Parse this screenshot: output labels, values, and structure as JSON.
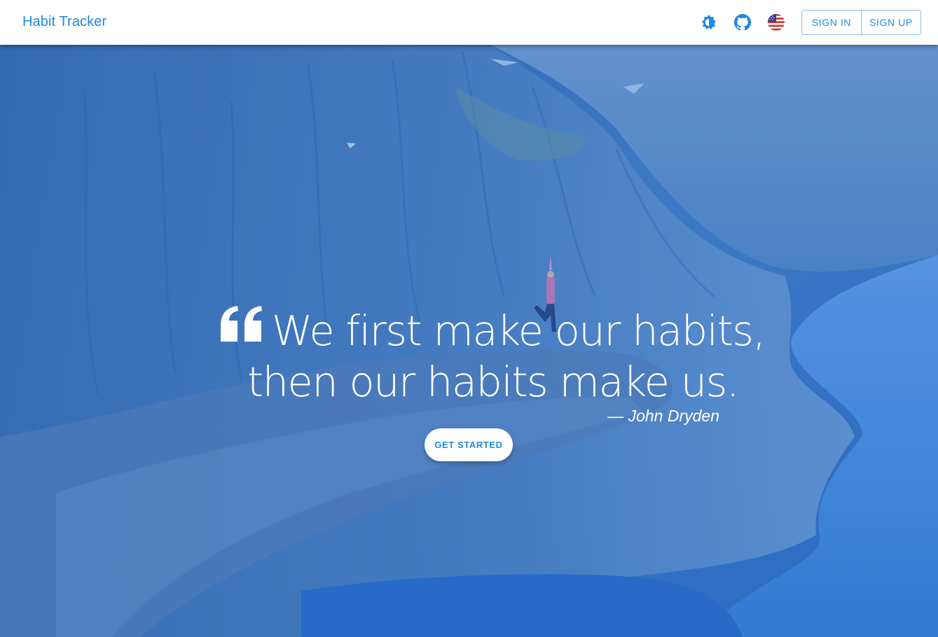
{
  "header": {
    "brand": "Habit Tracker",
    "theme_icon": "brightness-icon",
    "github_icon": "github-icon",
    "language_icon": "us-flag-icon",
    "sign_in_label": "SIGN IN",
    "sign_up_label": "SIGN UP"
  },
  "hero": {
    "quote_line_1": "We first make our habits,",
    "quote_line_2": "then our habits make us.",
    "author": "— John Dryden",
    "cta_label": "GET STARTED"
  },
  "colors": {
    "primary": "#1e88e5",
    "header_bg": "#ffffff",
    "hero_tint": "#2f6fbf"
  }
}
